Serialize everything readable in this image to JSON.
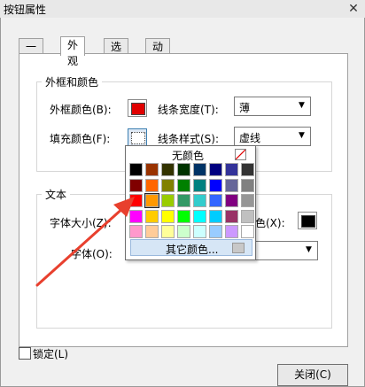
{
  "window": {
    "title": "按钮属性",
    "close_glyph": "✕"
  },
  "tabs": [
    {
      "label": "一般",
      "active": false
    },
    {
      "label": "外观",
      "active": true
    },
    {
      "label": "选项",
      "active": false
    },
    {
      "label": "动作",
      "active": false
    }
  ],
  "border_group": {
    "title": "外框和颜色",
    "border_color_label": "外框颜色(B):",
    "border_color": "#e00000",
    "line_width_label": "线条宽度(T):",
    "line_width_value": "薄",
    "fill_color_label": "填充颜色(F):",
    "line_style_label": "线条样式(S):",
    "line_style_value": "虚线"
  },
  "text_group": {
    "title": "文本",
    "font_size_label": "字体大小(Z):",
    "text_color_label_tail": "色(X):",
    "text_color": "#000000",
    "font_label": "字体(O):"
  },
  "color_popup": {
    "no_color_label": "无颜色",
    "more_colors_label": "其它颜色...",
    "selected_index": 17,
    "colors": [
      "#000000",
      "#993300",
      "#333300",
      "#003300",
      "#003366",
      "#000080",
      "#333399",
      "#333333",
      "#800000",
      "#ff6600",
      "#808000",
      "#008000",
      "#008080",
      "#0000ff",
      "#666699",
      "#808080",
      "#ff0000",
      "#ff9900",
      "#99cc00",
      "#339966",
      "#33cccc",
      "#3366ff",
      "#800080",
      "#969696",
      "#ff00ff",
      "#ffcc00",
      "#ffff00",
      "#00ff00",
      "#00ffff",
      "#00ccff",
      "#993366",
      "#c0c0c0",
      "#ff99cc",
      "#ffcc99",
      "#ffff99",
      "#ccffcc",
      "#ccffff",
      "#99ccff",
      "#cc99ff",
      "#ffffff"
    ]
  },
  "lock": {
    "label": "锁定(L)"
  },
  "close_button": {
    "label": "关闭(C)"
  }
}
